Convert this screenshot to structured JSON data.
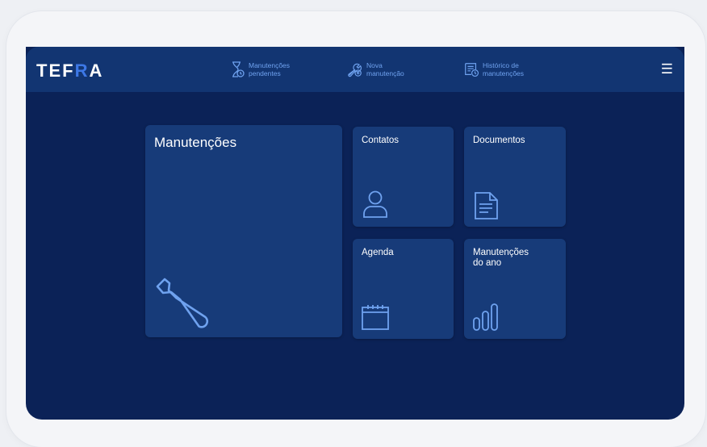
{
  "header": {
    "logo": {
      "pre": "TEF",
      "accent": "R",
      "post": "A"
    },
    "nav": [
      {
        "line1": "Manutenções",
        "line2": "pendentes",
        "icon": "hourglass-icon"
      },
      {
        "line1": "Nova",
        "line2": "manutenção",
        "icon": "wrench-icon"
      },
      {
        "line1": "Histórico de",
        "line2": "manutenções",
        "icon": "history-icon"
      }
    ],
    "menu_icon": "☰"
  },
  "tiles": {
    "maintenance": {
      "label": "Manutenções",
      "icon": "wrench-icon"
    },
    "contacts": {
      "label": "Contatos",
      "icon": "user-icon"
    },
    "documents": {
      "label": "Documentos",
      "icon": "document-icon"
    },
    "agenda": {
      "label": "Agenda",
      "icon": "calendar-icon"
    },
    "yearly": {
      "line1": "Manutenções",
      "line2": "do ano",
      "icon": "bar-chart-icon"
    }
  },
  "colors": {
    "background": "#0b2257",
    "topbar": "#123572",
    "tile": "#173b79",
    "icon": "#6fa2ef",
    "logo_accent": "#3d78e6"
  }
}
